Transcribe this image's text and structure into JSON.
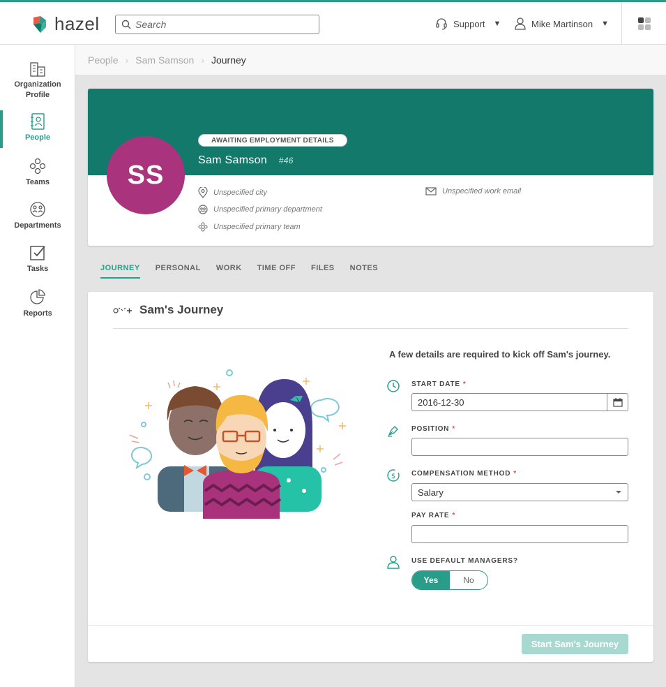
{
  "brand": {
    "name": "hazel"
  },
  "header": {
    "search_placeholder": "Search",
    "support_label": "Support",
    "user_name": "Mike Martinson"
  },
  "sidebar": {
    "items": [
      {
        "label": "Organization Profile",
        "icon": "building-icon",
        "active": false
      },
      {
        "label": "People",
        "icon": "people-book-icon",
        "active": true
      },
      {
        "label": "Teams",
        "icon": "teams-icon",
        "active": false
      },
      {
        "label": "Departments",
        "icon": "departments-icon",
        "active": false
      },
      {
        "label": "Tasks",
        "icon": "checkbox-icon",
        "active": false
      },
      {
        "label": "Reports",
        "icon": "pie-chart-icon",
        "active": false
      }
    ]
  },
  "breadcrumb": [
    "People",
    "Sam Samson",
    "Journey"
  ],
  "profile": {
    "initials": "SS",
    "status": "AWAITING EMPLOYMENT DETAILS",
    "name": "Sam Samson",
    "id": "#46",
    "city": "Unspecified city",
    "department": "Unspecified primary department",
    "team": "Unspecified primary team",
    "work_email": "Unspecified work email"
  },
  "tabs": [
    "JOURNEY",
    "PERSONAL",
    "WORK",
    "TIME OFF",
    "FILES",
    "NOTES"
  ],
  "journey": {
    "title": "Sam's Journey",
    "intro": "A few details are required to kick off Sam's journey.",
    "start_date_label": "START DATE",
    "start_date_value": "2016-12-30",
    "position_label": "POSITION",
    "position_value": "",
    "comp_label": "COMPENSATION METHOD",
    "comp_value": "Salary",
    "pay_rate_label": "PAY RATE",
    "pay_rate_value": "",
    "managers_label": "USE DEFAULT MANAGERS?",
    "yes_label": "Yes",
    "no_label": "No",
    "required_mark": "*",
    "start_button": "Start Sam's Journey"
  },
  "colors": {
    "accent": "#2a9d8a",
    "banner": "#137a6b",
    "avatar": "#a9337d",
    "button_disabled": "#a8d9d0"
  }
}
